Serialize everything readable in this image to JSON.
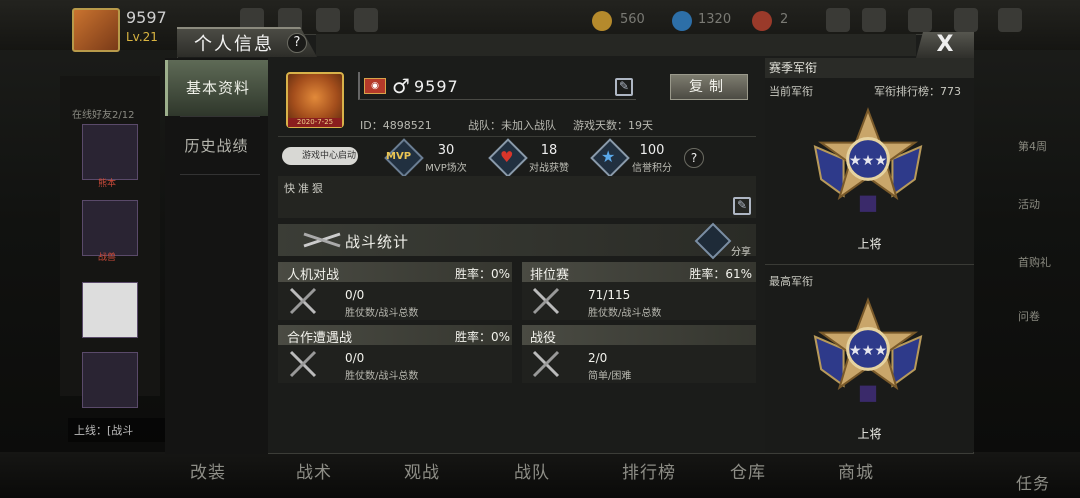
{
  "topbar": {
    "name": "9597",
    "level": "Lv.21",
    "coins": "560",
    "diamonds": "1320",
    "tickets": "2"
  },
  "background": {
    "online_friends": "在线好友2/12",
    "side_label_1": "熊本",
    "side_label_2": "战兽",
    "chat_text": "上线：[战斗"
  },
  "window": {
    "title": "个人信息",
    "help": "?",
    "close": "X"
  },
  "tabs": [
    {
      "label": "基本资料"
    },
    {
      "label": "历史战绩"
    }
  ],
  "profile": {
    "avatar_date": "2020-7-25",
    "rank_badge": "◉",
    "gender": "♂",
    "name": "9597",
    "copy_label": "复制",
    "id_label": "ID：4898521",
    "team_label": "战队：未加入战队",
    "days_label": "游戏天数：19天",
    "game_center": "游戏中心启动"
  },
  "stats": [
    {
      "value": "30",
      "label": "MVP场次",
      "icon": "MVP"
    },
    {
      "value": "18",
      "label": "对战获赞",
      "icon": "heart-icon"
    },
    {
      "value": "100",
      "label": "信誉积分",
      "icon": "star-icon"
    }
  ],
  "signature": "快准狠",
  "battle": {
    "title": "战斗统计",
    "share": "分享"
  },
  "cards": [
    {
      "title": "人机对战",
      "rate": "胜率：0%",
      "value": "0/0",
      "sub": "胜仗数/战斗总数"
    },
    {
      "title": "排位赛",
      "rate": "胜率：61%",
      "value": "71/115",
      "sub": "胜仗数/战斗总数"
    },
    {
      "title": "合作遭遇战",
      "rate": "胜率：0%",
      "value": "0/0",
      "sub": "胜仗数/战斗总数"
    },
    {
      "title": "战役",
      "rate": "",
      "value": "2/0",
      "sub": "简单/困难"
    }
  ],
  "season": {
    "header": "赛季军衔",
    "current_label": "当前军衔",
    "rank_board": "军衔排行榜：773",
    "current_rank": "上将",
    "highest_label": "最高军衔",
    "highest_rank": "上将"
  },
  "right_rail": [
    "第4周",
    "活动",
    "首购礼",
    "问卷"
  ],
  "bottom_nav": [
    "改装",
    "战术",
    "观战",
    "战队",
    "排行榜",
    "仓库",
    "商城",
    "任务"
  ],
  "colors": {
    "accent_gold": "#d8b24a",
    "tab_active": "#5e6a56",
    "medal_blue": "#2e3a8a"
  }
}
